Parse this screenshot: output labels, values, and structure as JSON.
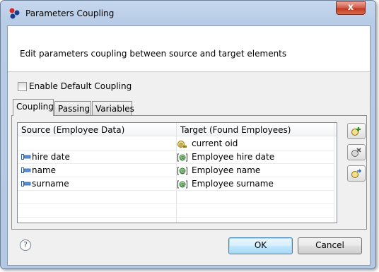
{
  "window": {
    "title": "Parameters Coupling",
    "close_glyph": "x"
  },
  "header": {
    "description": "Edit parameters coupling between source and target elements"
  },
  "enable_default_coupling": {
    "label": "Enable Default Coupling",
    "checked": false
  },
  "tabs": [
    {
      "label": "Coupling",
      "active": true
    },
    {
      "label": "Passing",
      "active": false
    },
    {
      "label": "Variables",
      "active": false
    }
  ],
  "table": {
    "columns": [
      "Source (Employee Data)",
      "Target (Found Employees)"
    ],
    "rows": [
      {
        "source": "",
        "source_icon": "",
        "target": "current oid",
        "target_icon": "oid-key-icon"
      },
      {
        "source": "hire date",
        "source_icon": "attribute-icon",
        "target": "Employee hire date",
        "target_icon": "attribute-box-icon"
      },
      {
        "source": "name",
        "source_icon": "attribute-icon",
        "target": "Employee name",
        "target_icon": "attribute-box-icon"
      },
      {
        "source": "surname",
        "source_icon": "attribute-icon",
        "target": "Employee surname",
        "target_icon": "attribute-box-icon"
      }
    ]
  },
  "side_buttons": [
    "add-coupling-icon",
    "remove-coupling-icon",
    "edit-coupling-icon"
  ],
  "footer": {
    "help_glyph": "?",
    "ok_label": "OK",
    "cancel_label": "Cancel"
  },
  "colors": {
    "title_bar": "#b8cce6",
    "close_button": "#c9452d",
    "dialog_bg": "#f0f0f0",
    "ok_default_border": "#3c7fb1"
  }
}
